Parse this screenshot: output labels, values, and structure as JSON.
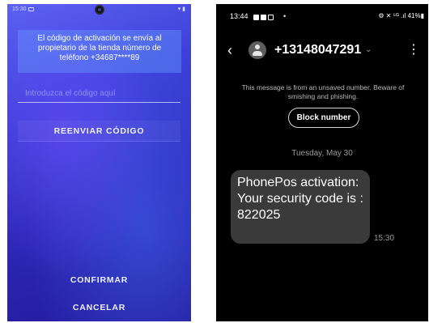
{
  "left_phone": {
    "statusbar": {
      "time": "15:30",
      "right": "▾ ▮"
    },
    "info_text": "El código de activación se envía al propietario de la tienda número de teléfono +34687****89",
    "code_placeholder": "Introduzca el código aquí",
    "resend_label": "REENVIAR CÓDIGO",
    "confirm_label": "CONFIRMAR",
    "cancel_label": "CANCELAR",
    "colors": {
      "background_top": "#5b63f0",
      "background_bottom": "#22199a",
      "info_box": "#6496ff"
    }
  },
  "right_phone": {
    "statusbar": {
      "time": "13:44",
      "dot": "•",
      "right": "⚙ ✕ ⁵ᴳ .ıl 41%▮"
    },
    "header": {
      "back_icon": "‹",
      "phone_number": "+13148047291",
      "chevron": "⌄",
      "more_icon": "⋮"
    },
    "warning_text": "This message is from an unsaved number. Beware of smishing and phishing.",
    "block_label": "Block number",
    "date_label": "Tuesday, May 30",
    "message": {
      "text": "PhonePos activation: Your security code is : 822025",
      "time": "15:30"
    },
    "colors": {
      "bubble": "#3a3a3a",
      "background": "#000000",
      "muted_text": "#9a9a9a"
    }
  }
}
